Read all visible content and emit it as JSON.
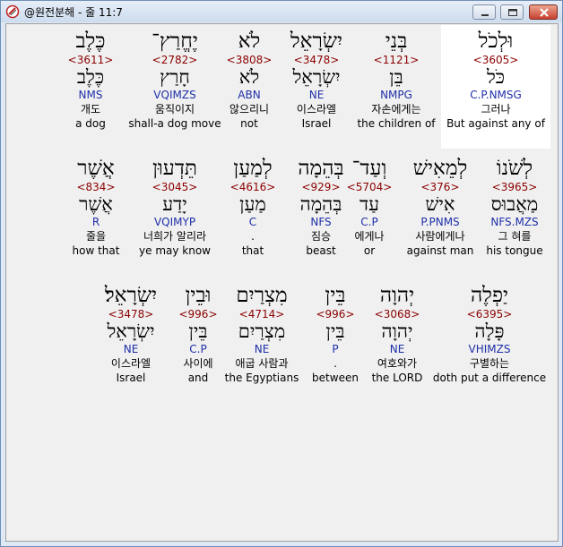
{
  "window": {
    "title": "@원전분해 - 줄 11:7",
    "controls": [
      "minimize",
      "maximize",
      "close"
    ],
    "close_color": "#c84030"
  },
  "colors": {
    "strong": "#8b0000",
    "morph": "#1f2fa8",
    "highlight": "#ffffff"
  },
  "rows": [
    [
      {
        "hebrew": "וּלְכֹל",
        "strong": "<3605>",
        "lemma": "כֹּל",
        "morph": "C.P.NMSG",
        "korean": "그러나",
        "english": "But against any of",
        "highlighted": true
      },
      {
        "hebrew": "בְּנֵי",
        "strong": "<1121>",
        "lemma": "בֵּן",
        "morph": "NMPG",
        "korean": "자손에게는",
        "english": "the children of"
      },
      {
        "hebrew": "יִשְׂרָאֵל",
        "strong": "<3478>",
        "lemma": "יִשְׂרָאֵל",
        "morph": "NE",
        "korean": "이스라엘",
        "english": "Israel"
      },
      {
        "hebrew": "לֹא",
        "strong": "<3808>",
        "lemma": "לֹא",
        "morph": "ABN",
        "korean": "않으리니",
        "english": "not"
      },
      {
        "hebrew": "יֶחֱרַץ־",
        "strong": "<2782>",
        "lemma": "חָרַץ",
        "morph": "VQIMZS",
        "korean": "움직이지",
        "english": "shall-a dog move"
      },
      {
        "hebrew": "כֶּלֶב",
        "strong": "<3611>",
        "lemma": "כֶּלֶב",
        "morph": "NMS",
        "korean": "개도",
        "english": "a dog"
      }
    ],
    [
      {
        "hebrew": "לְשֹׁנוֹ",
        "strong": "<3965>",
        "lemma": "מַאֲבוּס",
        "morph": "NFS.MZS",
        "korean": "그 혀를",
        "english": "his tongue"
      },
      {
        "hebrew": "לְמֵאִישׁ",
        "strong": "<376>",
        "lemma": "אִישׁ",
        "morph": "P.PNMS",
        "korean": "사람에게나",
        "english": "against man"
      },
      {
        "hebrew": "וְעַד־",
        "strong": "<5704>",
        "lemma": "עַד",
        "morph": "C.P",
        "korean": "에게나",
        "english": "or"
      },
      {
        "hebrew": "בְּהֵמָה",
        "strong": "<929>",
        "lemma": "בְּהֵמָה",
        "morph": "NFS",
        "korean": "짐승",
        "english": "beast"
      },
      {
        "hebrew": "לְמַעַן",
        "strong": "<4616>",
        "lemma": "מַעַן",
        "morph": "C",
        "korean": ".",
        "english": "that"
      },
      {
        "hebrew": "תֵּדְעוּן",
        "strong": "<3045>",
        "lemma": "יָדַע",
        "morph": "VQIMYP",
        "korean": "너희가 알리라",
        "english": "ye may know"
      },
      {
        "hebrew": "אֲשֶׁר",
        "strong": "<834>",
        "lemma": "אֲשֶׁר",
        "morph": "R",
        "korean": "줄을",
        "english": "how that"
      }
    ],
    [
      {
        "hebrew": "יַפְלֶה",
        "strong": "<6395>",
        "lemma": "פָּלָה",
        "morph": "VHIMZS",
        "korean": "구별하는",
        "english": "doth put a difference"
      },
      {
        "hebrew": "יְהוָה",
        "strong": "<3068>",
        "lemma": "יְהוָה",
        "morph": "NE",
        "korean": "여호와가",
        "english": "the LORD"
      },
      {
        "hebrew": "בֵּין",
        "strong": "<996>",
        "lemma": "בֵּין",
        "morph": "P",
        "korean": ".",
        "english": "between"
      },
      {
        "hebrew": "מִצְרַיִם",
        "strong": "<4714>",
        "lemma": "מִצְרַיִם",
        "morph": "NE",
        "korean": "애굽 사람과",
        "english": "the Egyptians"
      },
      {
        "hebrew": "וּבֵין",
        "strong": "<996>",
        "lemma": "בֵּין",
        "morph": "C.P",
        "korean": "사이에",
        "english": "and"
      },
      {
        "hebrew": "יִשְׂרָאֵל׃",
        "strong": "<3478>",
        "lemma": "יִשְׂרָאֵל",
        "morph": "NE",
        "korean": "이스라엘",
        "english": "Israel"
      }
    ]
  ]
}
